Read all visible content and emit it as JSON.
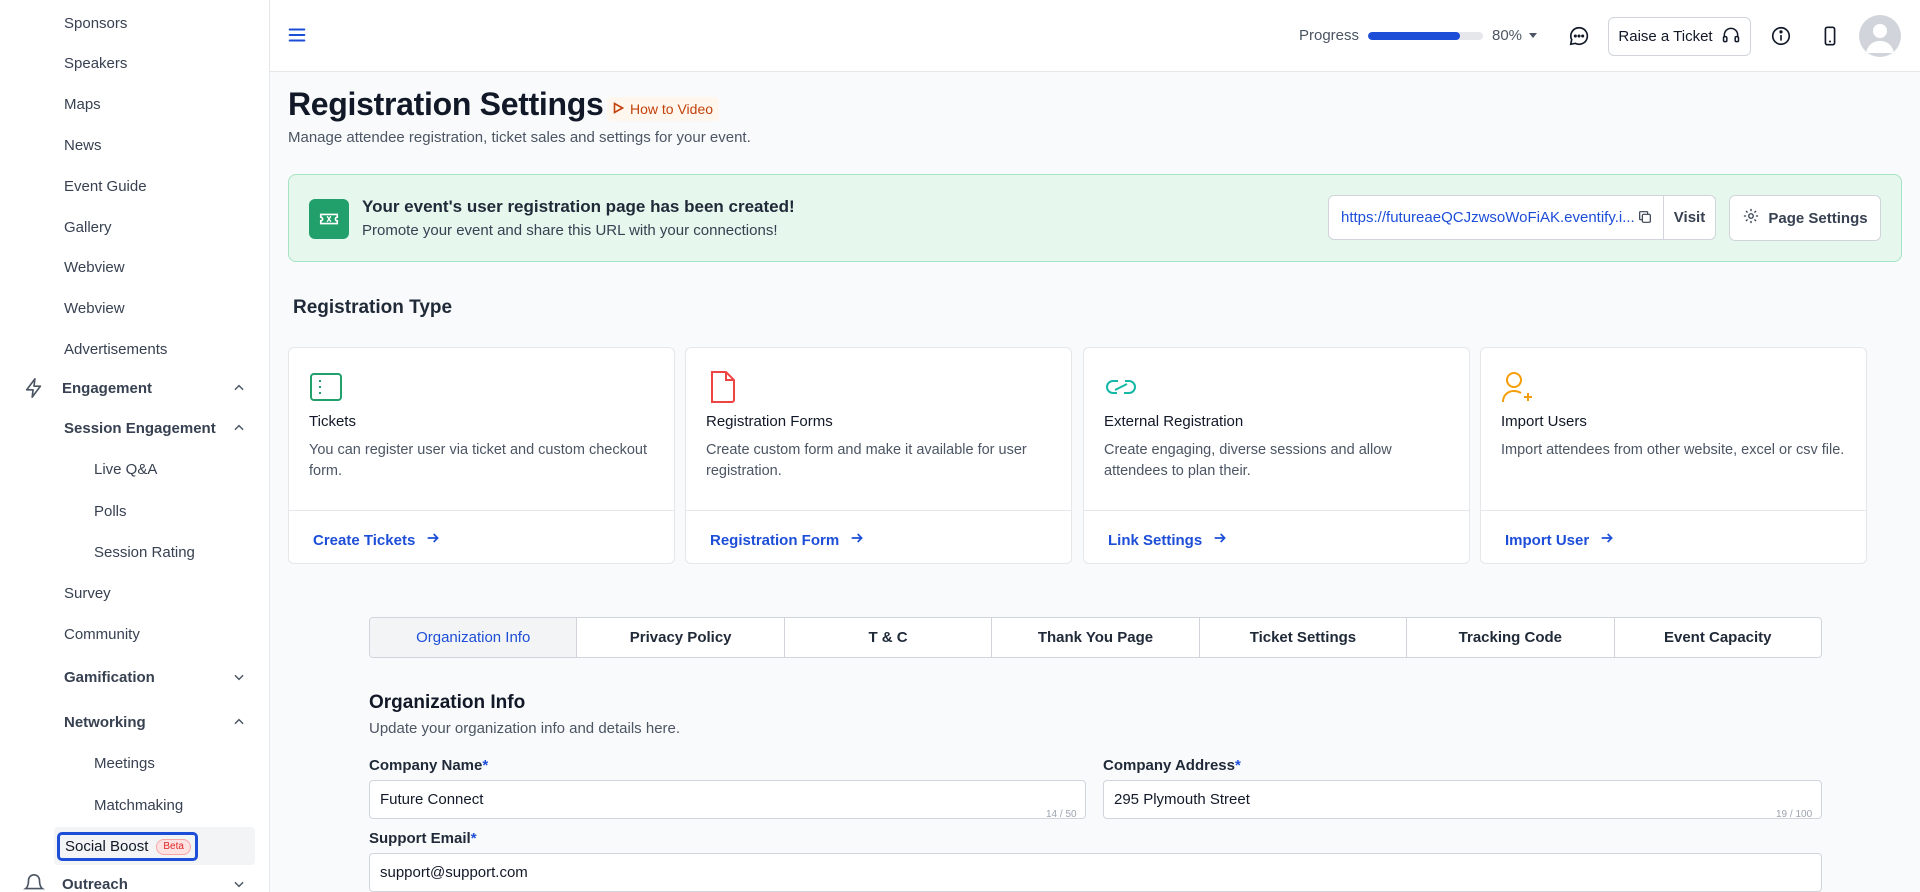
{
  "sidebar": {
    "items_top": [
      "Sponsors",
      "Speakers",
      "Maps",
      "News",
      "Event Guide",
      "Gallery",
      "Webview",
      "Webview",
      "Advertisements"
    ],
    "engagement": "Engagement",
    "session_engagement": "Session Engagement",
    "session_items": [
      "Live Q&A",
      "Polls",
      "Session Rating"
    ],
    "survey": "Survey",
    "community": "Community",
    "gamification": "Gamification",
    "networking": "Networking",
    "networking_items": [
      "Meetings",
      "Matchmaking"
    ],
    "social_boost": "Social Boost",
    "beta_badge": "Beta",
    "outreach": "Outreach"
  },
  "topbar": {
    "progress_label": "Progress",
    "progress_value": 80,
    "progress_text": "80%",
    "raise_ticket": "Raise a Ticket"
  },
  "page": {
    "title": "Registration Settings",
    "how_to": "How to Video",
    "subtitle": "Manage attendee registration, ticket sales and settings for your event."
  },
  "banner": {
    "title": "Your event's user registration page has been created!",
    "subtitle": "Promote your event and share this URL with your connections!",
    "url": "https://futureaeQCJzwsoWoFiAK.eventify.i...",
    "visit": "Visit",
    "page_settings": "Page Settings",
    "color": "#22a06b"
  },
  "registration_type": {
    "heading": "Registration Type",
    "cards": [
      {
        "icon": "ticket-icon",
        "title": "Tickets",
        "desc": "You can register user via ticket and custom checkout form.",
        "link": "Create Tickets",
        "color": "#22a06b"
      },
      {
        "icon": "file-icon",
        "title": "Registration Forms",
        "desc": "Create custom form and make it available for user registration.",
        "link": "Registration Form",
        "color": "#ef4444"
      },
      {
        "icon": "link-icon",
        "title": "External Registration",
        "desc": "Create engaging, diverse sessions and allow attendees to plan their.",
        "link": "Link Settings",
        "color": "#14b8a6"
      },
      {
        "icon": "user-plus-icon",
        "title": "Import Users",
        "desc": "Import attendees from other website, excel or csv file.",
        "link": "Import User",
        "color": "#f59e0b"
      }
    ]
  },
  "tabs": [
    "Organization Info",
    "Privacy Policy",
    "T & C",
    "Thank You Page",
    "Ticket Settings",
    "Tracking Code",
    "Event Capacity"
  ],
  "form": {
    "title": "Organization Info",
    "subtitle": "Update your organization info and details here.",
    "company_name_label": "Company Name",
    "company_name": "Future Connect",
    "company_name_count": "14 / 50",
    "company_address_label": "Company Address",
    "company_address": "295 Plymouth Street",
    "company_address_count": "19 / 100",
    "support_email_label": "Support Email",
    "support_email": "support@support.com",
    "required_mark": "*"
  }
}
